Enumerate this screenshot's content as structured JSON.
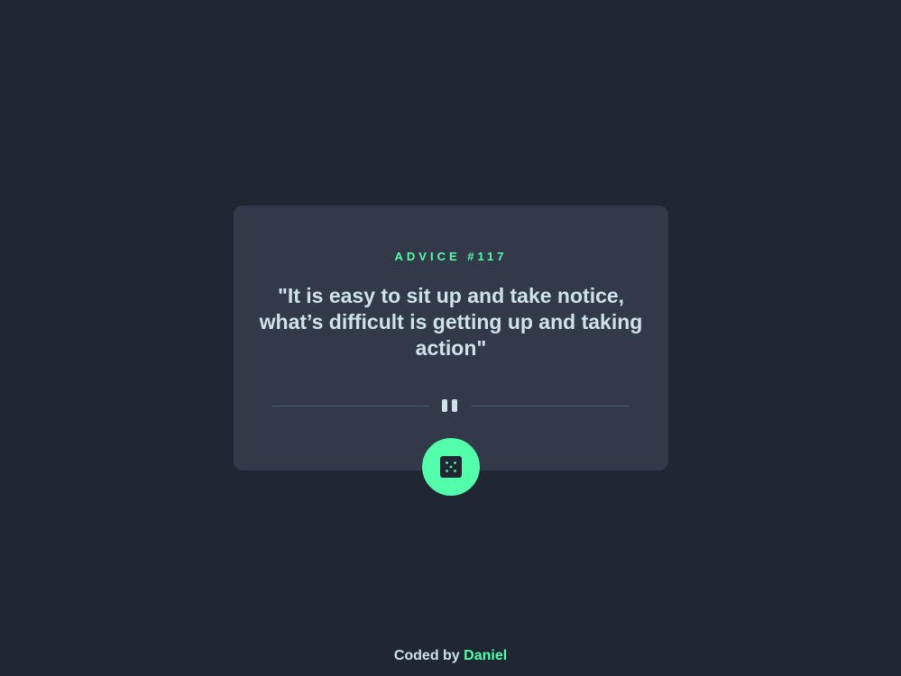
{
  "card": {
    "advice_label": "ADVICE #117",
    "quote": "\"It is easy to sit up and take notice, what’s difficult is getting up and taking action\""
  },
  "dice_button": {
    "icon": "dice-icon"
  },
  "footer": {
    "prefix": "Coded by",
    "author": "Daniel"
  },
  "colors": {
    "background": "#202632",
    "card": "#323A49",
    "accent": "#53FFAA",
    "text": "#CEE3E9",
    "divider": "#4F5D74"
  }
}
